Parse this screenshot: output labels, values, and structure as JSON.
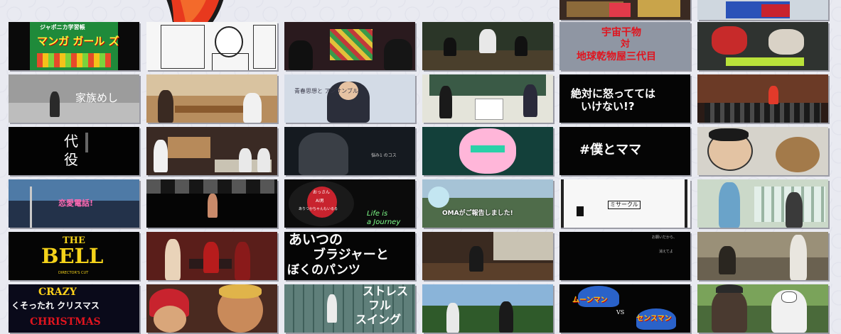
{
  "thumbnails": {
    "r1c1_title": "マンガ ガール ズ",
    "r1c1_sub": "ジャポニカ学習帳",
    "r1c5_line1": "宇宙干物",
    "r1c5_line2": "対",
    "r1c5_line3": "地球乾物屋三代目",
    "r2c1_title": "家族めし",
    "r2c3_caption": "青春思想と アンサンブル",
    "r2c5_line1": "絶対に怒ってては",
    "r2c5_line2": "いけない!?",
    "r3c1_title_top": "代",
    "r3c1_title_bottom": "役",
    "r3c3_caption": "悩み1 のコス",
    "r3c5_title": "#僕とママ",
    "r4c1_title": "恋愛電話!",
    "r4c3_line1": "おっさん",
    "r4c3_line2": "AI男",
    "r4c3_line3": "ありつかちゃんもいるる",
    "r4c3_life1": "Life is",
    "r4c3_life2": "a Journey",
    "r4c4_caption": "OMAがご報告しました!",
    "r4c5_label": "ミサークル",
    "r5c1_the": "THE",
    "r5c1_bell": "BELL",
    "r5c1_cut": "DIRECTOR'S CUT",
    "r5c3_line1": "あいつの",
    "r5c3_line2": "ブラジャーと",
    "r5c3_line3": "ぼくのパンツ",
    "r5c5_caption1": "お願いだから、",
    "r5c5_caption2": "消えてよ",
    "r6c1_crazy": "CRAZY",
    "r6c1_mid": "くそったれ クリスマス",
    "r6c1_christmas": "CHRISTMAS",
    "r6c3_line1": "ストレス",
    "r6c3_line2": "フル",
    "r6c3_line3": "スイング",
    "r6c5_left": "ムーンマン",
    "r6c5_vs": "VS",
    "r6c5_right": "センスマン"
  },
  "colors": {
    "background": "#e9eaf1",
    "flame_red": "#e8391e",
    "bell_yellow": "#f4d21a"
  }
}
